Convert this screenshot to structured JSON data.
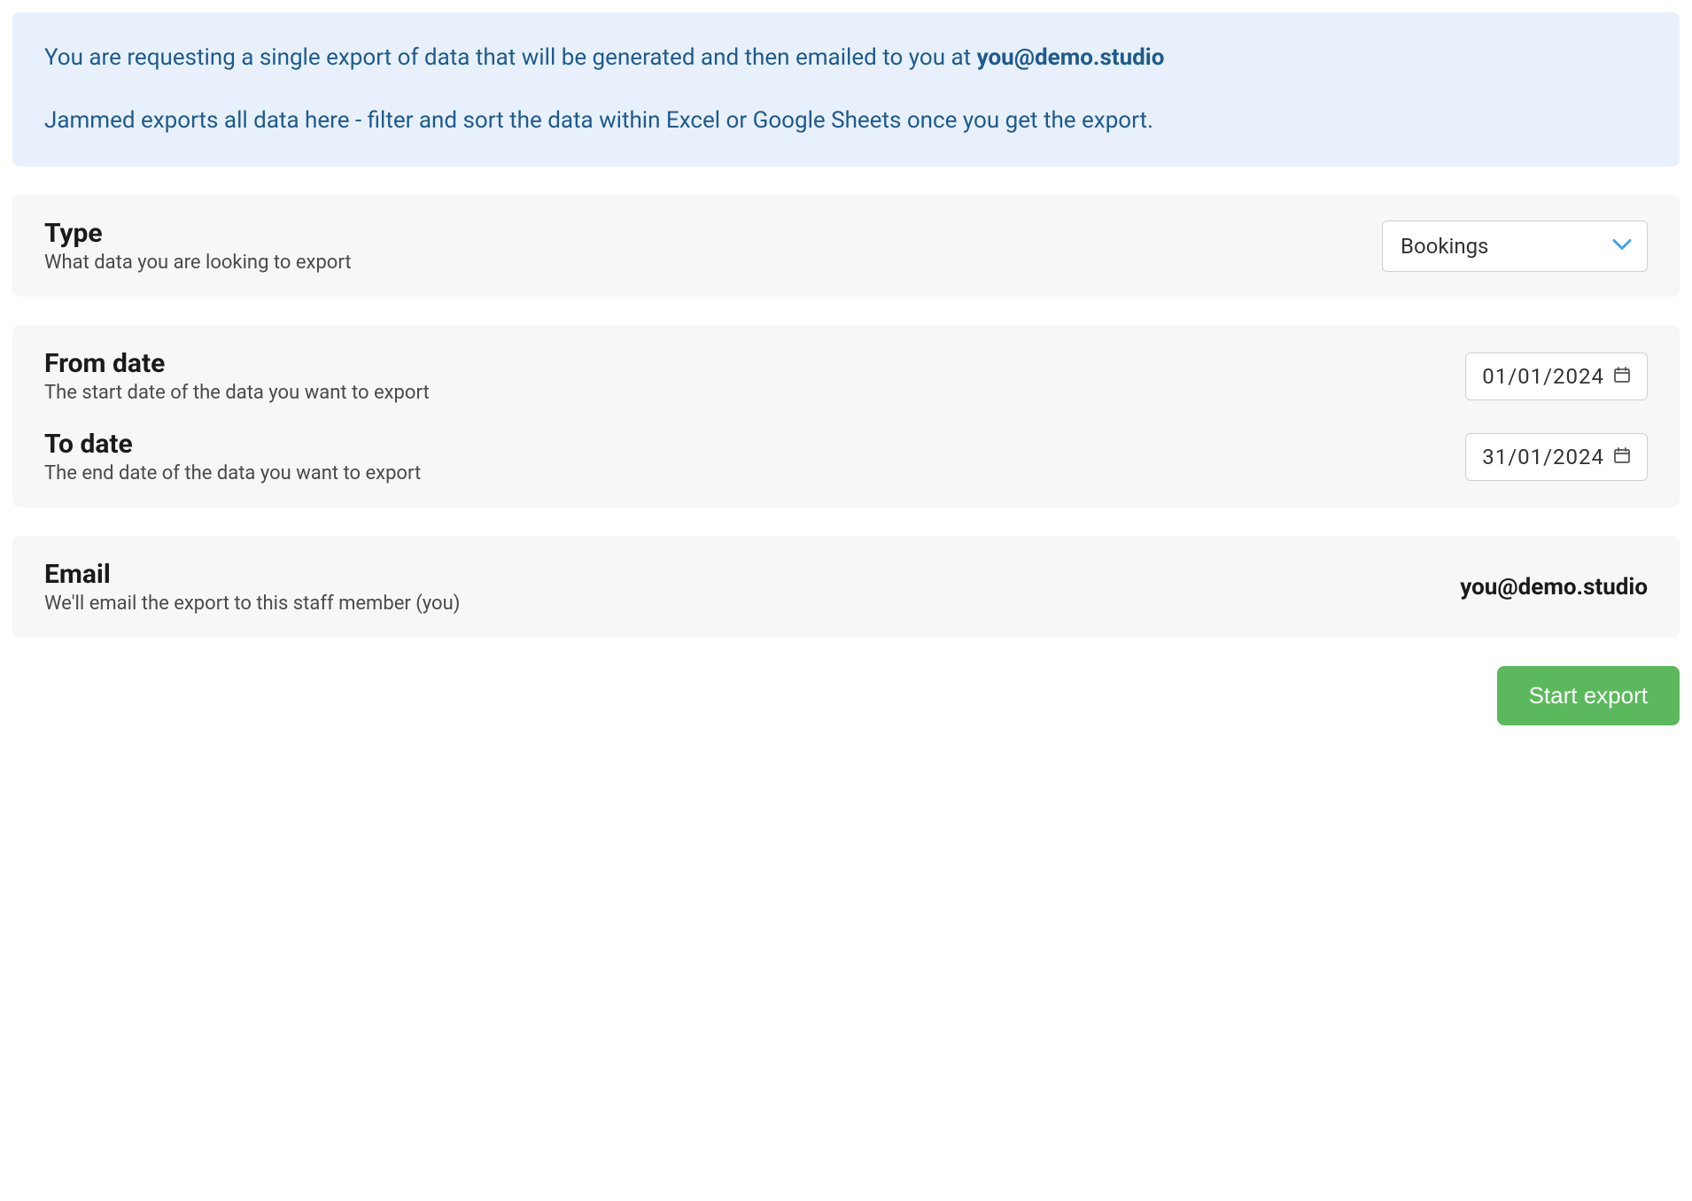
{
  "banner": {
    "intro_text": "You are requesting a single export of data that will be generated and then emailed to you at ",
    "email": "you@demo.studio",
    "details_text": "Jammed exports all data here - filter and sort the data within Excel or Google Sheets once you get the export."
  },
  "type_section": {
    "title": "Type",
    "desc": "What data you are looking to export",
    "selected": "Bookings"
  },
  "date_section": {
    "from_title": "From date",
    "from_desc": "The start date of the data you want to export",
    "from_value": "01/01/2024",
    "to_title": "To date",
    "to_desc": "The end date of the data you want to export",
    "to_value": "31/01/2024"
  },
  "email_section": {
    "title": "Email",
    "desc": "We'll email the export to this staff member (you)",
    "value": "you@demo.studio"
  },
  "actions": {
    "start_export": "Start export"
  }
}
